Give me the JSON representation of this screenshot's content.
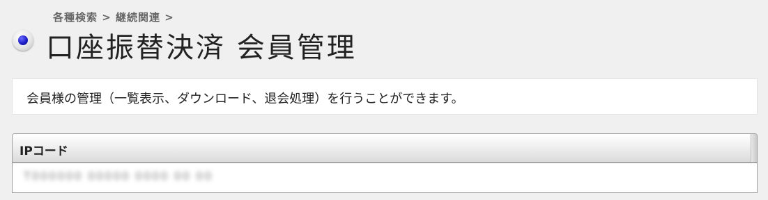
{
  "header": {
    "breadcrumb": "各種検索 > 継続関連 >",
    "title": "口座振替決済 会員管理"
  },
  "description": "会員様の管理（一覧表示、ダウンロード、退会処理）を行うことができます。",
  "table": {
    "column_header": "IPコード",
    "rows": [
      {
        "ip_code": "T000000 00000 0000 00 00"
      }
    ]
  },
  "colors": {
    "background": "#f0f0f0",
    "bullet_blue": "#1e1ec8"
  }
}
